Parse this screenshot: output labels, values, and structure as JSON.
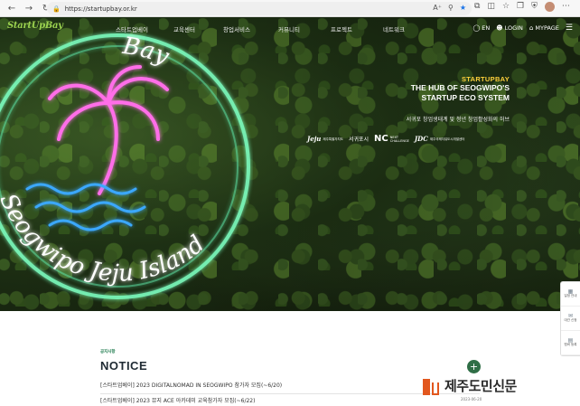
{
  "browser": {
    "url": "https://startupbay.or.kr",
    "nav_icons": [
      "back-icon",
      "forward-icon",
      "reload-icon"
    ],
    "accent": "#1a73e8"
  },
  "header": {
    "logo": "StartUpBay",
    "menu": [
      "스타트업베이",
      "교육센터",
      "창업서비스",
      "커뮤니티",
      "프로젝트",
      "네트워크"
    ],
    "lang": "EN",
    "login": "LOGIN",
    "mypage": "MYPAGE"
  },
  "hero": {
    "brand": "STARTUPBAY",
    "line1": "THE HUB OF SEOGWIPO'S",
    "line2": "STARTUP ECO SYSTEM",
    "kor": "서귀포 창업생태계 및 청년 창업활성화의 허브",
    "partners": {
      "jeju": "Jeju",
      "jeju_sub": "제주특별자치도",
      "seogwipo": "서귀포시",
      "nc_mark": "NC",
      "nc_sub1": "NEXT",
      "nc_sub2": "CHALLENGE",
      "jdc_mark": "JDC",
      "jdc_sub": "제주국제자유도시개발센터"
    },
    "neon_text_top": "Bay",
    "neon_text_bottom": "Seogwipo Jeju Island"
  },
  "notice": {
    "kicker": "공지사항",
    "title": "NOTICE",
    "items": [
      "[스타트업베이] 2023 DIGITALNOMAD IN SEOGWIPO 참가자 모집(~6/20)",
      "[스타트업베이] 2023 뮤지 ACE 아카데미 교육참가자 모집(~6/22)"
    ],
    "more": "+",
    "date": "2023-06-20"
  },
  "quick_menu": [
    {
      "icon": "calendar-icon",
      "label": "일정 안내"
    },
    {
      "icon": "chat-icon",
      "label": "대관 신청"
    },
    {
      "icon": "doc-icon",
      "label": "멤버 등록"
    }
  ],
  "watermark": "제주도민신문"
}
